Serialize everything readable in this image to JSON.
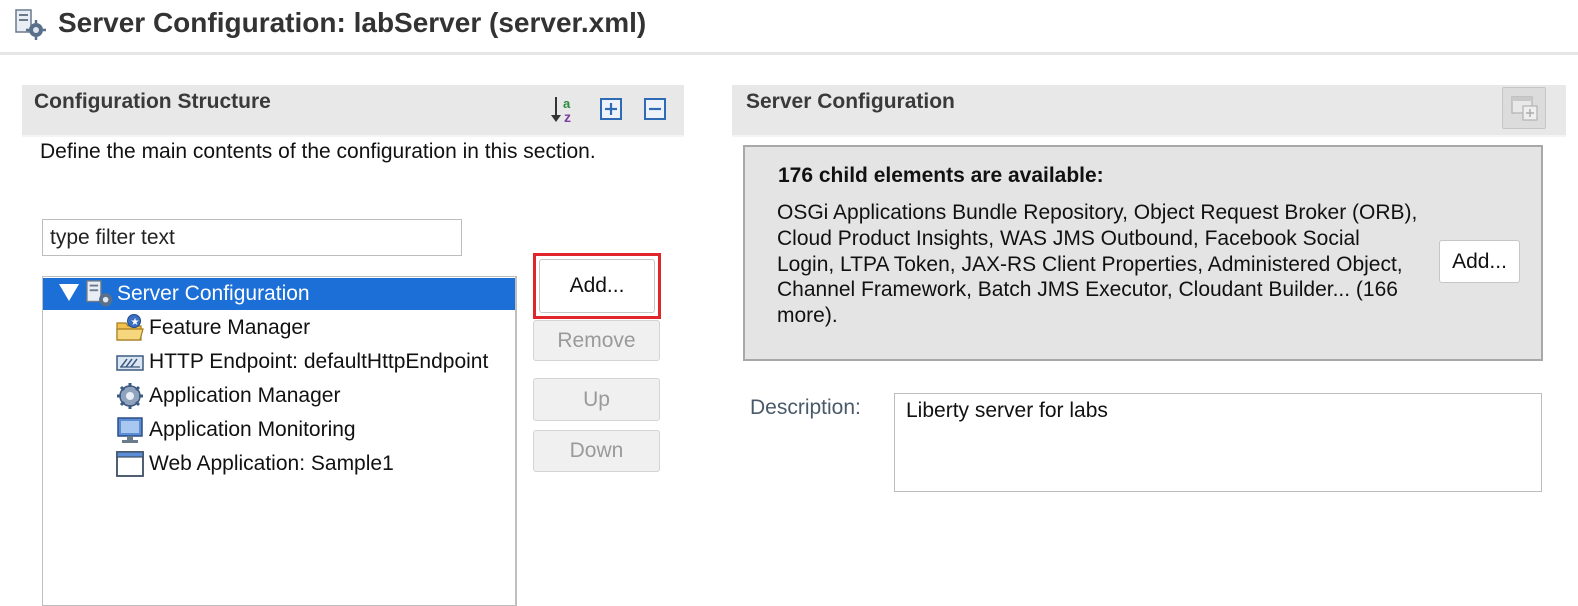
{
  "header": {
    "title": "Server Configuration: labServer (server.xml)",
    "icon": "server-config-icon"
  },
  "structure_section": {
    "title": "Configuration Structure",
    "description": "Define the main contents of the configuration in this section.",
    "toolbar": {
      "sort_icon": "sort-az-icon",
      "expand_icon": "expand-all-icon",
      "collapse_icon": "collapse-all-icon"
    },
    "filter": {
      "placeholder": "type filter text",
      "value": ""
    },
    "tree": {
      "root": {
        "label": "Server Configuration",
        "icon": "server-config-icon",
        "expanded": true,
        "selected": true
      },
      "children": [
        {
          "label": "Feature Manager",
          "icon": "feature-manager-icon"
        },
        {
          "label": "HTTP Endpoint: defaultHttpEndpoint",
          "icon": "http-endpoint-icon"
        },
        {
          "label": "Application Manager",
          "icon": "application-manager-icon"
        },
        {
          "label": "Application Monitoring",
          "icon": "monitor-icon"
        },
        {
          "label": "Web Application: Sample1",
          "icon": "web-application-icon"
        }
      ]
    },
    "buttons": {
      "add": "Add...",
      "remove": "Remove",
      "up": "Up",
      "down": "Down"
    }
  },
  "details_section": {
    "title": "Server Configuration",
    "info": {
      "title": "176 child elements are available:",
      "text": "OSGi Applications Bundle Repository, Object Request Broker (ORB), Cloud Product Insights, WAS JMS Outbound, Facebook Social Login, LTPA Token, JAX-RS Client Properties, Administered Object, Channel Framework, Batch JMS Executor, Cloudant Builder... (166 more).",
      "add_button": "Add..."
    },
    "description_label": "Description:",
    "description_value": "Liberty server for labs"
  },
  "colors": {
    "selection": "#1c6fd6",
    "highlight_border": "#e0262a",
    "section_header_bg": "#e8e8e8",
    "info_panel_bg": "#e4e4e4"
  }
}
